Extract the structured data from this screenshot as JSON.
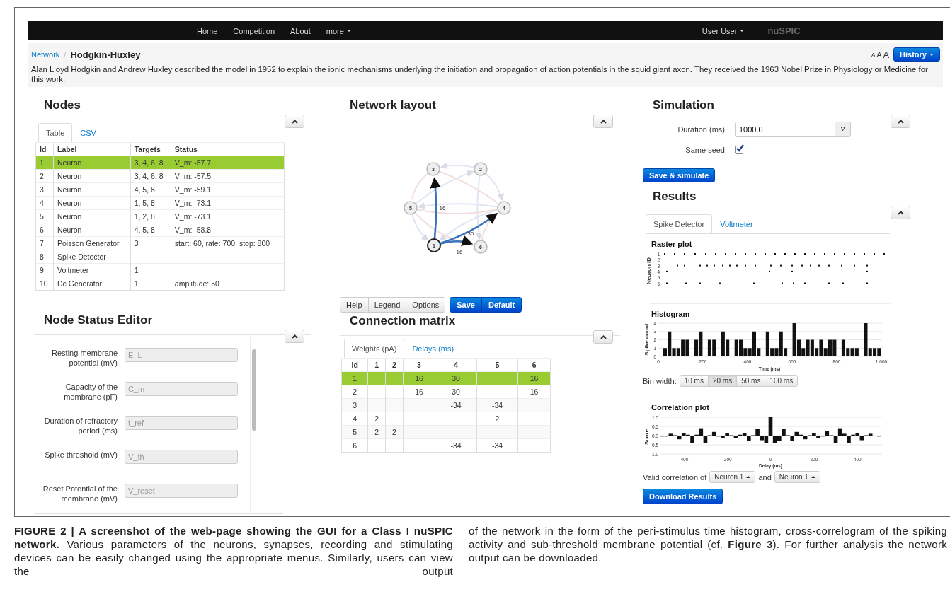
{
  "navbar": {
    "links": [
      {
        "label": "Home",
        "has_menu": false
      },
      {
        "label": "Competition",
        "has_menu": false
      },
      {
        "label": "About",
        "has_menu": false
      },
      {
        "label": "more",
        "has_menu": true
      }
    ],
    "user": "User User",
    "brand": "nuSPIC"
  },
  "breadcrumb": {
    "parent": "Network",
    "separator": "/",
    "current": "Hodgkin-Huxley"
  },
  "text_size_links": [
    "A",
    "A",
    "A"
  ],
  "history_button": "History",
  "description": "Alan Lloyd Hodgkin and Andrew Huxley described the model in 1952 to explain the ionic mechanisms underlying the initiation and propagation of action potentials in the squid giant axon. They received the 1963 Nobel Prize in Physiology or Medicine for this work.",
  "nodes": {
    "title": "Nodes",
    "tabs": [
      {
        "label": "Table",
        "selected": true
      },
      {
        "label": "CSV",
        "selected": false
      }
    ],
    "columns": [
      "Id",
      "Label",
      "Targets",
      "Status"
    ],
    "rows": [
      {
        "cells": [
          "1",
          "Neuron",
          "3, 4, 6, 8",
          "V_m: -57.7"
        ],
        "selected": true
      },
      {
        "cells": [
          "2",
          "Neuron",
          "3, 4, 6, 8",
          "V_m: -57.5"
        ],
        "selected": false
      },
      {
        "cells": [
          "3",
          "Neuron",
          "4, 5, 8",
          "V_m: -59.1"
        ],
        "selected": false
      },
      {
        "cells": [
          "4",
          "Neuron",
          "1, 5, 8",
          "V_m: -73.1"
        ],
        "selected": false
      },
      {
        "cells": [
          "5",
          "Neuron",
          "1, 2, 8",
          "V_m: -73.1"
        ],
        "selected": false
      },
      {
        "cells": [
          "6",
          "Neuron",
          "4, 5, 8",
          "V_m: -58.8"
        ],
        "selected": false
      },
      {
        "cells": [
          "7",
          "Poisson Generator",
          "3",
          "start: 60, rate: 700, stop: 800"
        ],
        "selected": false
      },
      {
        "cells": [
          "8",
          "Spike Detector",
          "",
          ""
        ],
        "selected": false
      },
      {
        "cells": [
          "9",
          "Voltmeter",
          "1",
          ""
        ],
        "selected": false
      },
      {
        "cells": [
          "10",
          "Dc Generator",
          "1",
          "amplitude: 50"
        ],
        "selected": false
      }
    ]
  },
  "node_status_editor": {
    "title": "Node Status Editor",
    "fields": [
      {
        "label": "Resting membrane potential (mV)",
        "placeholder": "E_L"
      },
      {
        "label": "Capacity of the membrane (pF)",
        "placeholder": "C_m"
      },
      {
        "label": "Duration of refractory period (ms)",
        "placeholder": "t_ref"
      },
      {
        "label": "Spike threshold (mV)",
        "placeholder": "V_th"
      },
      {
        "label": "Reset Potential of the membrane (mV)",
        "placeholder": "V_reset"
      }
    ]
  },
  "network_layout": {
    "title": "Network layout",
    "nodes": [
      {
        "label": "1",
        "selected": true
      },
      {
        "label": "2",
        "selected": false
      },
      {
        "label": "3",
        "selected": false
      },
      {
        "label": "4",
        "selected": false
      },
      {
        "label": "5",
        "selected": false
      },
      {
        "label": "6",
        "selected": false
      }
    ],
    "edge_labels": [
      "16",
      "30",
      "16"
    ]
  },
  "layout_buttons": [
    {
      "label": "Help",
      "kind": "default"
    },
    {
      "label": "Legend",
      "kind": "default"
    },
    {
      "label": "Options",
      "kind": "default"
    },
    {
      "label": "Save",
      "kind": "primary"
    },
    {
      "label": "Default",
      "kind": "primary"
    }
  ],
  "connection_matrix": {
    "title": "Connection matrix",
    "tabs": [
      {
        "label": "Weights (pA)",
        "selected": true
      },
      {
        "label": "Delays (ms)",
        "selected": false
      }
    ],
    "columns": [
      "Id",
      "1",
      "2",
      "3",
      "4",
      "5",
      "6"
    ],
    "rows": [
      {
        "cells": [
          "1",
          "",
          "",
          "16",
          "30",
          "",
          "16"
        ],
        "selected": true
      },
      {
        "cells": [
          "2",
          "",
          "",
          "16",
          "30",
          "",
          "16"
        ],
        "selected": false
      },
      {
        "cells": [
          "3",
          "",
          "",
          "",
          "-34",
          "-34",
          ""
        ],
        "selected": false
      },
      {
        "cells": [
          "4",
          "2",
          "",
          "",
          "",
          "2",
          ""
        ],
        "selected": false
      },
      {
        "cells": [
          "5",
          "2",
          "2",
          "",
          "",
          "",
          ""
        ],
        "selected": false
      },
      {
        "cells": [
          "6",
          "",
          "",
          "",
          "-34",
          "-34",
          ""
        ],
        "selected": false
      }
    ]
  },
  "simulation": {
    "title": "Simulation",
    "duration_label": "Duration (ms)",
    "duration_value": "1000.0",
    "help_button": "?",
    "same_seed_label": "Same seed",
    "same_seed_checked": true,
    "submit": "Save & simulate"
  },
  "results": {
    "title": "Results",
    "tabs": [
      {
        "label": "Spike Detector",
        "selected": true
      },
      {
        "label": "Voltmeter",
        "selected": false
      }
    ],
    "raster": {
      "title": "Raster plot",
      "ylabel": "Neuron ID",
      "neuron_ids": [
        "1",
        "2",
        "3",
        "4",
        "5",
        "6"
      ]
    },
    "histogram": {
      "chart_data": {
        "type": "bar",
        "title": "Histogram",
        "xlabel": "Time (ms)",
        "ylabel": "Spike count",
        "grid": true,
        "x": [
          10,
          30,
          50,
          70,
          90,
          110,
          130,
          150,
          170,
          190,
          210,
          230,
          250,
          270,
          290,
          310,
          330,
          350,
          370,
          390,
          410,
          430,
          450,
          470,
          490,
          510,
          530,
          550,
          570,
          590,
          610,
          630,
          650,
          670,
          690,
          710,
          730,
          750,
          770,
          790,
          810,
          830,
          850,
          870,
          890,
          910,
          930,
          950,
          970,
          990
        ],
        "values": [
          0,
          1,
          3,
          1,
          1,
          2,
          2,
          0,
          2,
          3,
          0,
          2,
          2,
          0,
          3,
          2,
          0,
          2,
          2,
          1,
          1,
          3,
          1,
          0,
          3,
          1,
          1,
          3,
          1,
          0,
          4,
          2,
          1,
          2,
          2,
          1,
          2,
          1,
          2,
          2,
          0,
          2,
          1,
          1,
          1,
          0,
          4,
          1,
          1,
          1
        ],
        "xlim": [
          0,
          1000
        ],
        "ylim": [
          0,
          4
        ],
        "xticks": [
          {
            "value": 0,
            "label": "0"
          },
          {
            "value": 200,
            "label": "200"
          },
          {
            "value": 400,
            "label": "400"
          },
          {
            "value": 600,
            "label": "600"
          },
          {
            "value": 800,
            "label": "800"
          },
          {
            "value": 1000,
            "label": "1,000"
          }
        ],
        "yticks": [
          {
            "value": 0,
            "label": "0"
          },
          {
            "value": 1,
            "label": "1"
          },
          {
            "value": 2,
            "label": "2"
          },
          {
            "value": 3,
            "label": "3"
          },
          {
            "value": 4,
            "label": "4"
          }
        ]
      }
    },
    "bin_width": {
      "label": "Bin width:",
      "options": [
        {
          "label": "10 ms",
          "selected": false
        },
        {
          "label": "20 ms",
          "selected": true
        },
        {
          "label": "50 ms",
          "selected": false
        },
        {
          "label": "100 ms",
          "selected": false
        }
      ]
    },
    "correlation": {
      "chart_data": {
        "type": "bar",
        "title": "Correlation plot",
        "xlabel": "Delay (ms)",
        "ylabel": "Score",
        "grid": true,
        "x": [
          -500,
          -480,
          -460,
          -440,
          -420,
          -400,
          -380,
          -360,
          -340,
          -320,
          -300,
          -280,
          -260,
          -240,
          -220,
          -200,
          -180,
          -160,
          -140,
          -120,
          -100,
          -80,
          -60,
          -40,
          -20,
          0,
          20,
          40,
          60,
          80,
          100,
          120,
          140,
          160,
          180,
          200,
          220,
          240,
          260,
          280,
          300,
          320,
          340,
          360,
          380,
          400,
          420,
          440,
          460,
          480,
          500
        ],
        "values": [
          -0.05,
          -0.05,
          0.1,
          0,
          -0.2,
          0.15,
          0.05,
          -0.4,
          0.05,
          0.4,
          -0.4,
          0,
          0.2,
          -0.05,
          -0.15,
          0.15,
          0,
          -0.15,
          0.05,
          0.15,
          -0.3,
          0,
          0.35,
          -0.25,
          -0.4,
          1.0,
          -0.4,
          -0.3,
          0.35,
          0,
          -0.3,
          0.2,
          0.05,
          -0.2,
          0,
          0.15,
          -0.15,
          -0.05,
          0.25,
          0,
          -0.4,
          0.4,
          0.1,
          -0.4,
          0.05,
          0.15,
          -0.25,
          0,
          0.1,
          -0.02,
          -0.05
        ],
        "xlim": [
          -510,
          510
        ],
        "ylim": [
          -1,
          1
        ],
        "xticks": [
          {
            "value": -400,
            "label": "-400"
          },
          {
            "value": -200,
            "label": "-200"
          },
          {
            "value": 0,
            "label": "0"
          },
          {
            "value": 200,
            "label": "200"
          },
          {
            "value": 400,
            "label": "400"
          }
        ],
        "yticks": [
          {
            "value": -1,
            "label": "-1.0"
          },
          {
            "value": -0.5,
            "label": "-0.5"
          },
          {
            "value": 0,
            "label": "0.0"
          },
          {
            "value": 0.5,
            "label": "0.5"
          },
          {
            "value": 1,
            "label": "1.0"
          }
        ]
      }
    },
    "valid_correlation": {
      "label": "Valid correlation of",
      "first": "Neuron 1",
      "joiner": "and",
      "second": "Neuron 1"
    },
    "download": "Download Results"
  },
  "caption_columns": [
    "**FIGURE 2 | A screenshot of the web-page showing the GUI for a Class I nuSPIC network.** Various parameters of the neurons, synapses, recording and stimulating devices can be easily changed using the appropriate menus. Similarly, users can view the output",
    "of the network in the form of the peri-stimulus time histogram, cross-correlogram of the spiking activity and sub-threshold membrane potential (cf. **Figure 3**). For further analysis the network output can be downloaded."
  ]
}
